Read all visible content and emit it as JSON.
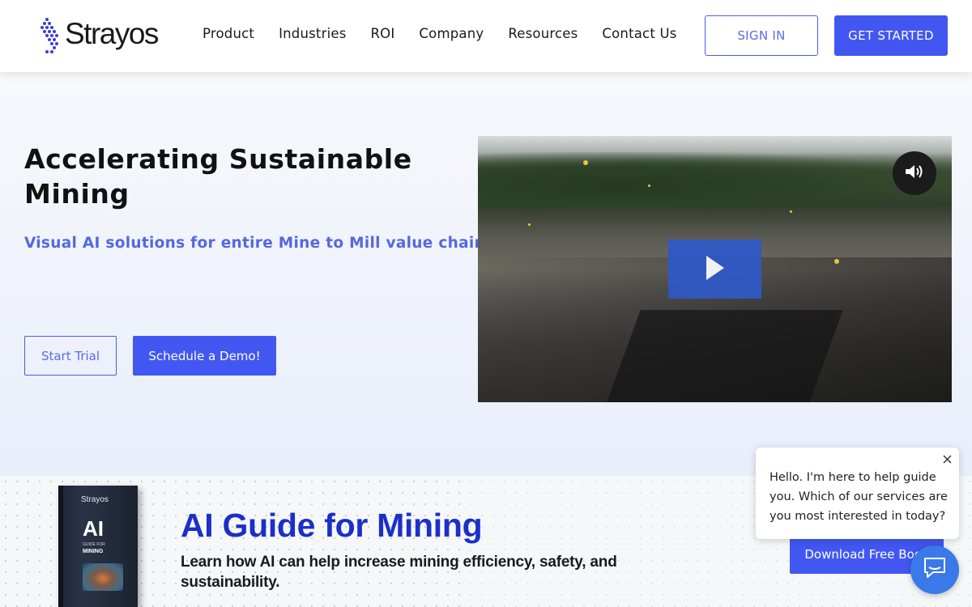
{
  "brand": {
    "name": "Strayos"
  },
  "nav": {
    "items": [
      "Product",
      "Industries",
      "ROI",
      "Company",
      "Resources",
      "Contact Us"
    ],
    "sign_in": "SIGN IN",
    "get_started": "GET STARTED"
  },
  "hero": {
    "title": "Accelerating Sustainable Mining",
    "subtitle": "Visual AI solutions for entire Mine to Mill value chain",
    "start_trial": "Start Trial",
    "schedule_demo": "Schedule a Demo!"
  },
  "video": {
    "mute_icon": "speaker-icon",
    "play_icon": "play-icon"
  },
  "banner": {
    "book_brand": "Strayos",
    "book_ai": "AI",
    "book_guide": "GUIDE FOR",
    "book_mining": "MINING",
    "title": "AI Guide for Mining",
    "subtitle": "Learn how AI can help increase mining efficiency, safety, and sustainability.",
    "download": "Download Free Book"
  },
  "chat": {
    "message": "Hello. I'm here to help guide you. Which of our services are you most interested in today?",
    "close_icon": "close-icon",
    "launcher_icon": "chat-icon"
  },
  "colors": {
    "accent": "#4257f2",
    "subtitle": "#5468e0",
    "banner_title": "#1b2fc9",
    "chat_launcher": "#3b78ea"
  }
}
